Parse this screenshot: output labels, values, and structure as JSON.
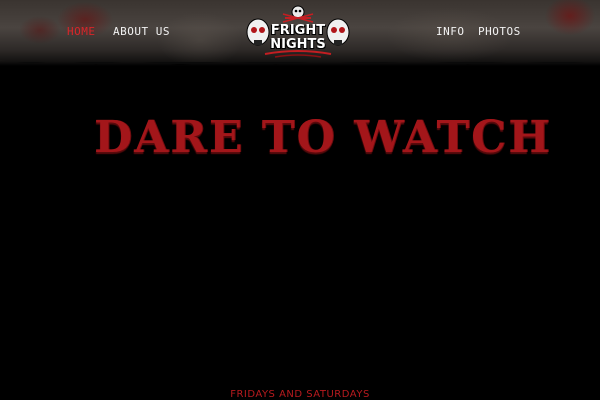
{
  "nav": {
    "left": [
      {
        "label": "Home",
        "active": true
      },
      {
        "label": "About Us",
        "active": false
      }
    ],
    "right": [
      {
        "label": "Info",
        "active": false
      },
      {
        "label": "Photos",
        "active": false
      }
    ]
  },
  "logo": {
    "line1": "FRIGHT",
    "line2": "NIGHTS",
    "icon": "skull-logo-icon"
  },
  "hero": {
    "headline": "Dare to Watch",
    "subline": "Fridays and Saturdays"
  },
  "colors": {
    "accent": "#d8262a",
    "headline": "#a3161a",
    "background": "#000000"
  }
}
